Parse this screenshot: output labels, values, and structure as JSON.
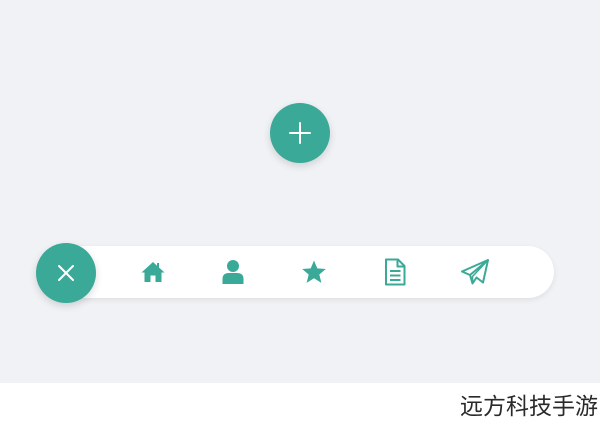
{
  "colors": {
    "background": "#f1f2f5",
    "accent": "#3aa997",
    "bar_background": "#ffffff",
    "icon_on_accent": "#ffffff"
  },
  "fab": {
    "expand_icon": "plus-icon",
    "close_icon": "close-icon"
  },
  "toolbar": {
    "items": [
      {
        "icon": "home-icon"
      },
      {
        "icon": "user-icon"
      },
      {
        "icon": "star-icon"
      },
      {
        "icon": "document-icon"
      },
      {
        "icon": "send-icon"
      }
    ]
  },
  "watermark": {
    "text": "远方科技手游"
  }
}
